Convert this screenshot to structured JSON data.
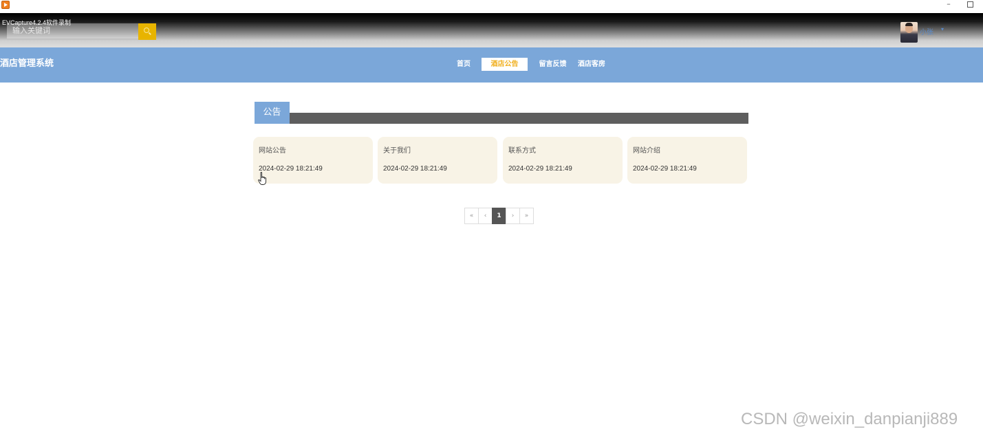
{
  "window": {
    "icon": "app-record-icon"
  },
  "topbar": {
    "recorder_label": "EVCapture4.2.4软件录制",
    "search_placeholder": "输入关键词",
    "search_icon": "search-icon",
    "username": "小张",
    "user_caret": "▾"
  },
  "nav": {
    "site_title": "酒店管理系统",
    "items": [
      {
        "label": "首页",
        "active": false
      },
      {
        "label": "酒店公告",
        "active": true
      },
      {
        "label": "留言反馈",
        "active": false
      },
      {
        "label": "酒店客房",
        "active": false
      }
    ]
  },
  "section": {
    "title": "公告"
  },
  "cards": [
    {
      "title": "网站公告",
      "date": "2024-02-29 18:21:49"
    },
    {
      "title": "关于我们",
      "date": "2024-02-29 18:21:49"
    },
    {
      "title": "联系方式",
      "date": "2024-02-29 18:21:49"
    },
    {
      "title": "网站介绍",
      "date": "2024-02-29 18:21:49"
    }
  ],
  "pagination": {
    "first": "«",
    "prev": "‹",
    "current": "1",
    "next": "›",
    "last": "»"
  },
  "watermark": "CSDN @weixin_danpianji889",
  "colors": {
    "nav_bg": "#7ba7d9",
    "active_nav_text": "#f0b020",
    "search_button": "#e8b400",
    "card_bg": "#f8f3e6",
    "section_bar": "#5e5e5e"
  }
}
